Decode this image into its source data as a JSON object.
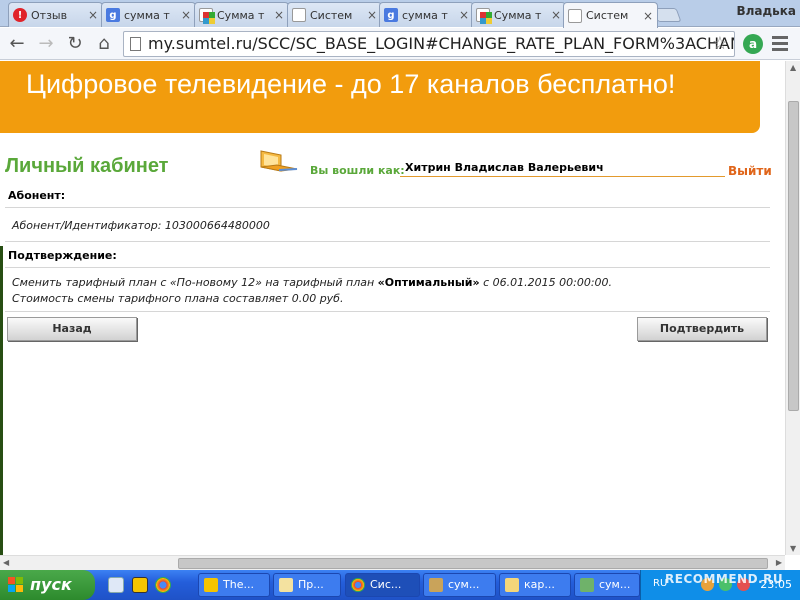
{
  "browser": {
    "tabs": [
      {
        "icon": "otzovik-icon",
        "label": "Отзыв"
      },
      {
        "icon": "google-icon",
        "label": "сумма т"
      },
      {
        "icon": "sumtel-icon",
        "label": "Сумма т"
      },
      {
        "icon": "document-icon",
        "label": "Систем"
      },
      {
        "icon": "google-icon",
        "label": "сумма т"
      },
      {
        "icon": "sumtel-icon",
        "label": "Сумма т"
      },
      {
        "icon": "document-icon",
        "label": "Систем"
      }
    ],
    "profile_name": "Владька",
    "url": "my.sumtel.ru/SCC/SC_BASE_LOGIN#CHANGE_RATE_PLAN_FORM%3ACHAN"
  },
  "page": {
    "banner_text": "Цифровое телевидение - до 17 каналов бесплатно!",
    "cabinet_title": "Личный кабинет",
    "logged_in_label": "Вы вошли как:",
    "user_name": "Хитрин Владислав Валерьевич",
    "logout_label": "Выйти",
    "subscriber_heading": "Абонент:",
    "subscriber_id_text": "Абонент/Идентификатор: 103000664480000",
    "confirmation_heading": "Подтверждение:",
    "change_line_prefix": "Сменить тарифный план с «По-новому 12» на тарифный план ",
    "change_line_plan": "«Оптимальный»",
    "change_line_suffix": " с 06.01.2015 00:00:00.",
    "cost_line": "Стоимость смены тарифного плана составляет 0.00 руб.",
    "back_button": "Назад",
    "confirm_button": "Подтвердить"
  },
  "taskbar": {
    "start_label": "пуск",
    "tasks": [
      "The...",
      "Пр...",
      "Сис...",
      "сум...",
      "кар...",
      "сум..."
    ],
    "language": "RU",
    "clock": "23:05"
  },
  "watermark": "RECOMMEND.RU"
}
